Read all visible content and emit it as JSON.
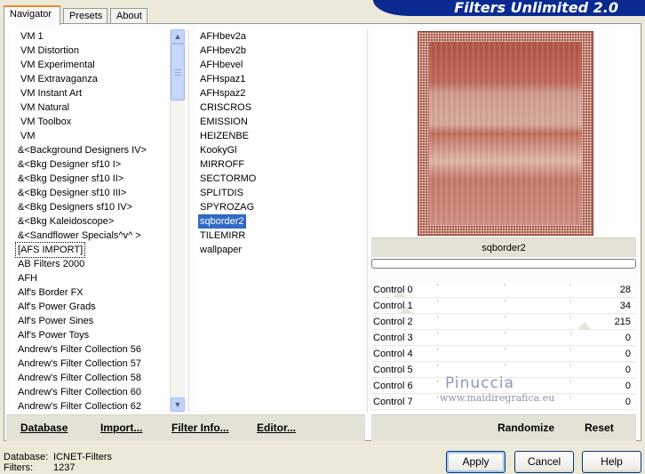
{
  "window": {
    "banner_title": "Filters Unlimited 2.0"
  },
  "tabs": [
    {
      "label": "Navigator",
      "active": true
    },
    {
      "label": "Presets",
      "active": false
    },
    {
      "label": "About",
      "active": false
    }
  ],
  "categories": [
    "VM 1",
    "VM Distortion",
    "VM Experimental",
    "VM Extravaganza",
    "VM Instant Art",
    "VM Natural",
    "VM Toolbox",
    "VM",
    "&<Background Designers IV>",
    "&<Bkg Designer sf10 I>",
    "&<Bkg Designer sf10 II>",
    "&<Bkg Designer sf10 III>",
    "&<Bkg Designers sf10 IV>",
    "&<Bkg Kaleidoscope>",
    "&<Sandflower Specials^v^ >",
    "[AFS IMPORT]",
    "AB Filters 2000",
    "AFH",
    "Alf's Border FX",
    "Alf's Power Grads",
    "Alf's Power Sines",
    "Alf's Power Toys",
    "Andrew's Filter Collection 56",
    "Andrew's Filter Collection 57",
    "Andrew's Filter Collection 58",
    "Andrew's Filter Collection 60",
    "Andrew's Filter Collection 62"
  ],
  "selected_category": "[AFS IMPORT]",
  "filters": [
    "AFHbev2a",
    "AFHbev2b",
    "AFHbevel",
    "AFHspaz1",
    "AFHspaz2",
    "CRISCROS",
    "EMISSION",
    "HEIZENBE",
    "KookyGl",
    "MIRROFF",
    "SECTORMO",
    "SPLITDIS",
    "SPYROZAG",
    "sqborder2",
    "TILEMIRR",
    "wallpaper"
  ],
  "selected_filter": "sqborder2",
  "preview": {
    "filter_name": "sqborder2"
  },
  "controls": [
    {
      "label": "Control 0",
      "value": "28"
    },
    {
      "label": "Control 1",
      "value": "34"
    },
    {
      "label": "Control 2",
      "value": "215"
    },
    {
      "label": "Control 3",
      "value": "0"
    },
    {
      "label": "Control 4",
      "value": "0"
    },
    {
      "label": "Control 5",
      "value": "0"
    },
    {
      "label": "Control 6",
      "value": "0"
    },
    {
      "label": "Control 7",
      "value": "0"
    }
  ],
  "left_buttons": {
    "database": "Database",
    "import": "Import...",
    "filter_info": "Filter Info...",
    "editor": "Editor..."
  },
  "right_buttons": {
    "randomize": "Randomize",
    "reset": "Reset"
  },
  "status": {
    "database_label": "Database:",
    "database_value": "ICNET-Filters",
    "filters_label": "Filters:",
    "filters_value": "1237"
  },
  "dialog_buttons": {
    "apply": "Apply",
    "cancel": "Cancel",
    "help": "Help"
  },
  "watermark": {
    "name": "Pinuccia",
    "url": "www.maidiregrafica.eu"
  },
  "colors": {
    "selection": "#316ac5",
    "banner": "#0a2a92",
    "tab_accent": "#e68b2c"
  }
}
